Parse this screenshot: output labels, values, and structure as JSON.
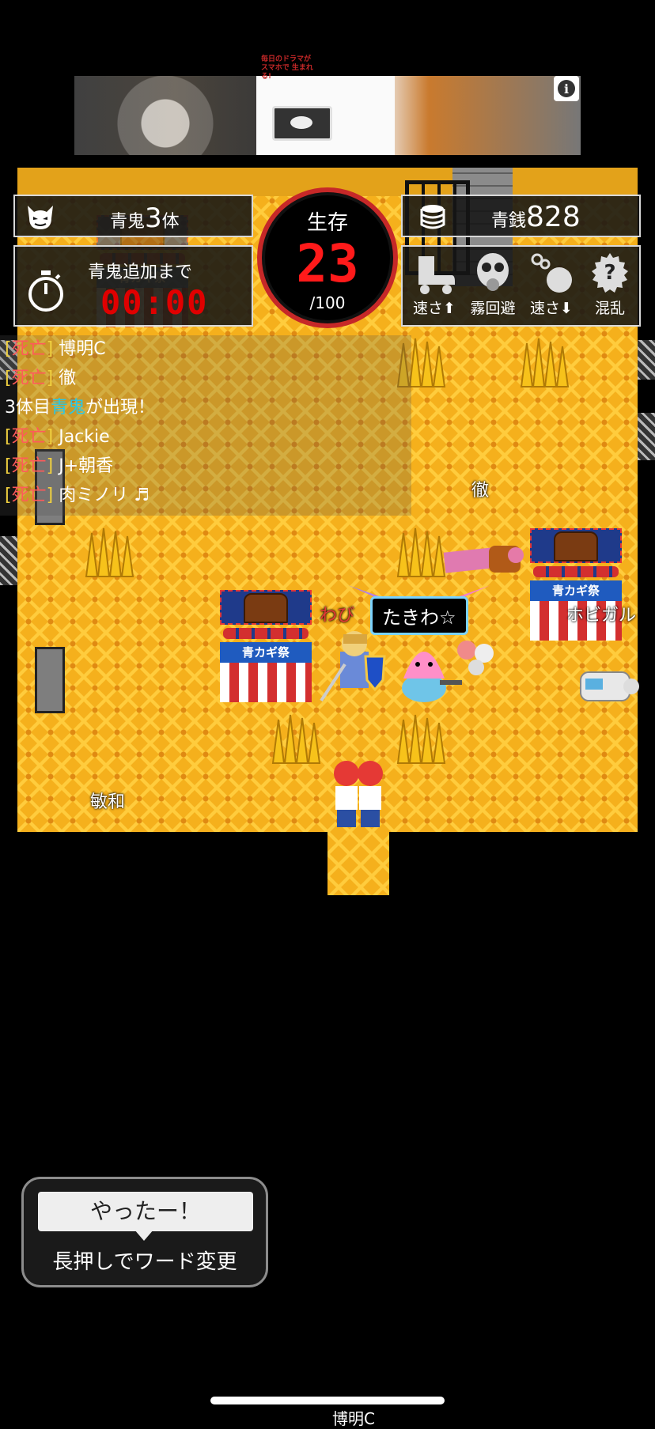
{
  "ad": {
    "text": "毎日のドラマが スマホで 生まれる!",
    "info_icon": "info-icon"
  },
  "hud": {
    "enemy": {
      "prefix": "青鬼",
      "count": "3",
      "suffix": "体",
      "icon": "demon-icon"
    },
    "timer": {
      "label": "青鬼追加まで",
      "value": "00:00",
      "icon": "stopwatch-icon"
    },
    "survivors": {
      "label": "生存",
      "count": "23",
      "max": "/100"
    },
    "money": {
      "prefix": "青銭",
      "amount": "828",
      "icon": "coins-icon"
    },
    "items": [
      {
        "label": "速さ⬆",
        "icon": "roller-skate-icon"
      },
      {
        "label": "霧回避",
        "icon": "gas-mask-icon"
      },
      {
        "label": "速さ⬇",
        "icon": "ball-and-chain-icon"
      },
      {
        "label": "混乱",
        "icon": "question-icon"
      }
    ]
  },
  "chat": {
    "tag_open": "[",
    "tag_word": "死亡",
    "tag_close": "]",
    "lines": [
      {
        "name": "博明C"
      },
      {
        "name": "徹"
      },
      {
        "system_pre": "3体目",
        "system_mid": "青鬼",
        "system_post": "が出現！"
      },
      {
        "name": "Jackie"
      },
      {
        "name": "J+朝香"
      },
      {
        "name": "肉ミノリ ♬"
      }
    ]
  },
  "board": {
    "booth_sign": "青カギ祭",
    "players": {
      "toru": "徹",
      "wabi": "わび",
      "takiwa": "たきわ☆",
      "hobi": "ホビガル",
      "toshikazu": "敏和"
    }
  },
  "bubble": {
    "phrase": "やったー！",
    "hint": "長押しでワード変更"
  },
  "bottom": {
    "name": "博明C"
  },
  "colors": {
    "board": "#f5b01c",
    "timer_red": "#e00000",
    "survive_ring": "#c62828",
    "chat_tag": "#f0d040",
    "enemy_cyan": "#29c7e6"
  }
}
